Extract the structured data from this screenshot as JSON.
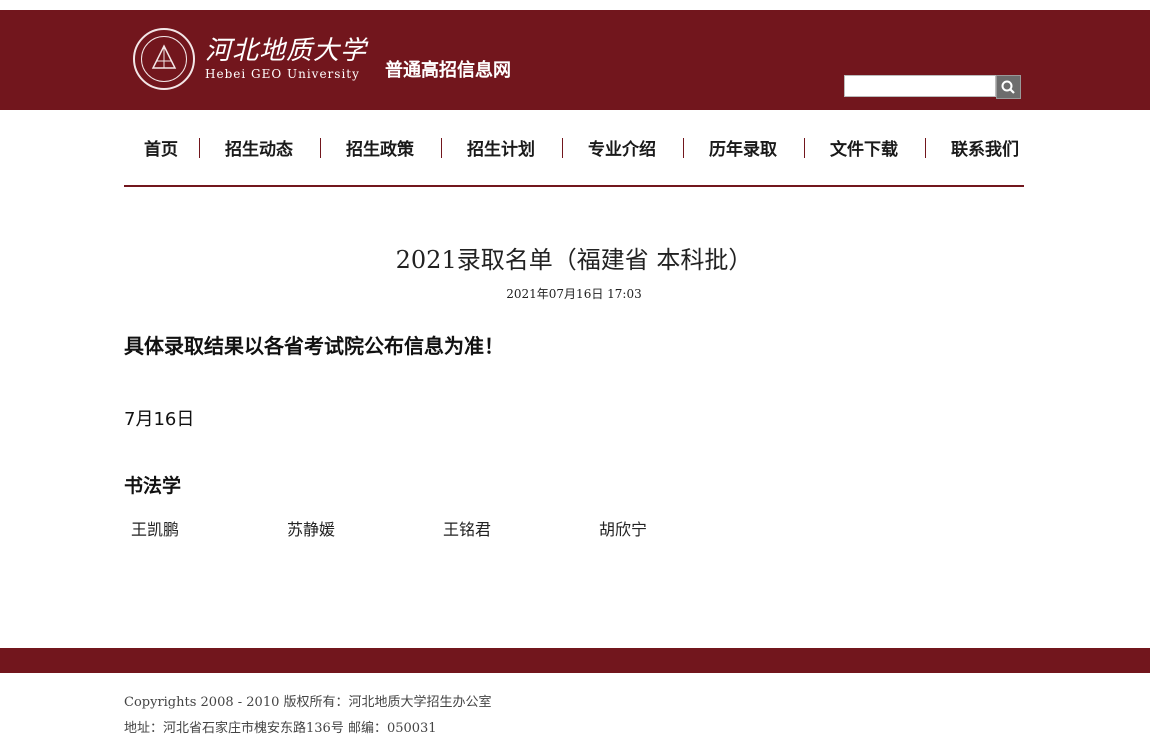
{
  "header": {
    "logo_cn": "河北地质大学",
    "logo_en": "Hebei GEO University",
    "site_name": "普通高招信息网",
    "search_placeholder": "",
    "search_icon": "search-icon",
    "brand_color": "#72161d"
  },
  "nav": {
    "items": [
      {
        "label": "首页"
      },
      {
        "label": "招生动态"
      },
      {
        "label": "招生政策"
      },
      {
        "label": "招生计划"
      },
      {
        "label": "专业介绍"
      },
      {
        "label": "历年录取"
      },
      {
        "label": "文件下载"
      },
      {
        "label": "联系我们"
      }
    ]
  },
  "article": {
    "title": "2021录取名单（福建省 本科批）",
    "date": "2021年07月16日 17:03",
    "notice": "具体录取结果以各省考试院公布信息为准！",
    "date_line": "7月16日",
    "major": "书法学",
    "students": [
      "王凯鹏",
      "苏静媛",
      "王铭君",
      "胡欣宁"
    ]
  },
  "footer": {
    "copyright": "Copyrights  2008 - 2010  版权所有：河北地质大学招生办公室",
    "address": "地址：河北省石家庄市槐安东路136号  邮编：050031"
  }
}
